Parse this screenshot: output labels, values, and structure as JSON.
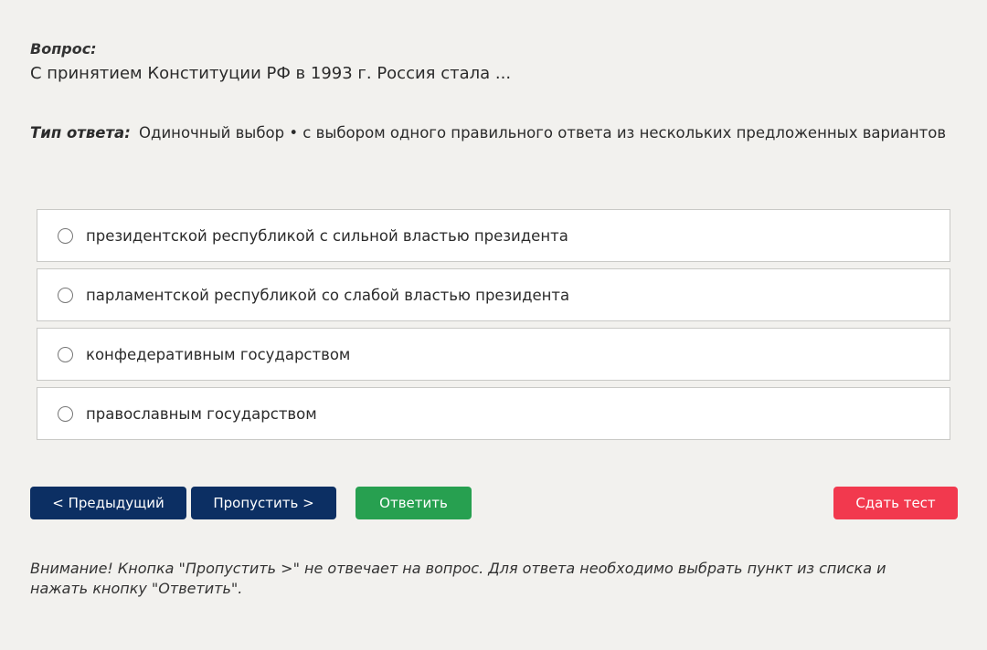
{
  "question": {
    "label": "Вопрос:",
    "text": "С принятием Конституции РФ в 1993 г. Россия стала ..."
  },
  "answer_type": {
    "label": "Тип ответа:",
    "value": "Одиночный выбор • с выбором одного правильного ответа из нескольких предложенных вариантов"
  },
  "options": [
    {
      "label": "президентской республикой с сильной властью президента",
      "selected": false
    },
    {
      "label": "парламентской республикой со слабой властью президента",
      "selected": false
    },
    {
      "label": "конфедеративным государством",
      "selected": false
    },
    {
      "label": "православным государством",
      "selected": false
    }
  ],
  "buttons": {
    "prev": "< Предыдущий",
    "skip": "Пропустить >",
    "answer": "Ответить",
    "finish": "Сдать тест"
  },
  "colors": {
    "background": "#f2f1ee",
    "nav_button": "#0c2f63",
    "answer_button": "#27a050",
    "finish_button": "#f2394e"
  },
  "notice": "Внимание! Кнопка \"Пропустить >\" не отвечает на вопрос. Для ответа необходимо выбрать пункт из списка и нажать кнопку \"Ответить\"."
}
